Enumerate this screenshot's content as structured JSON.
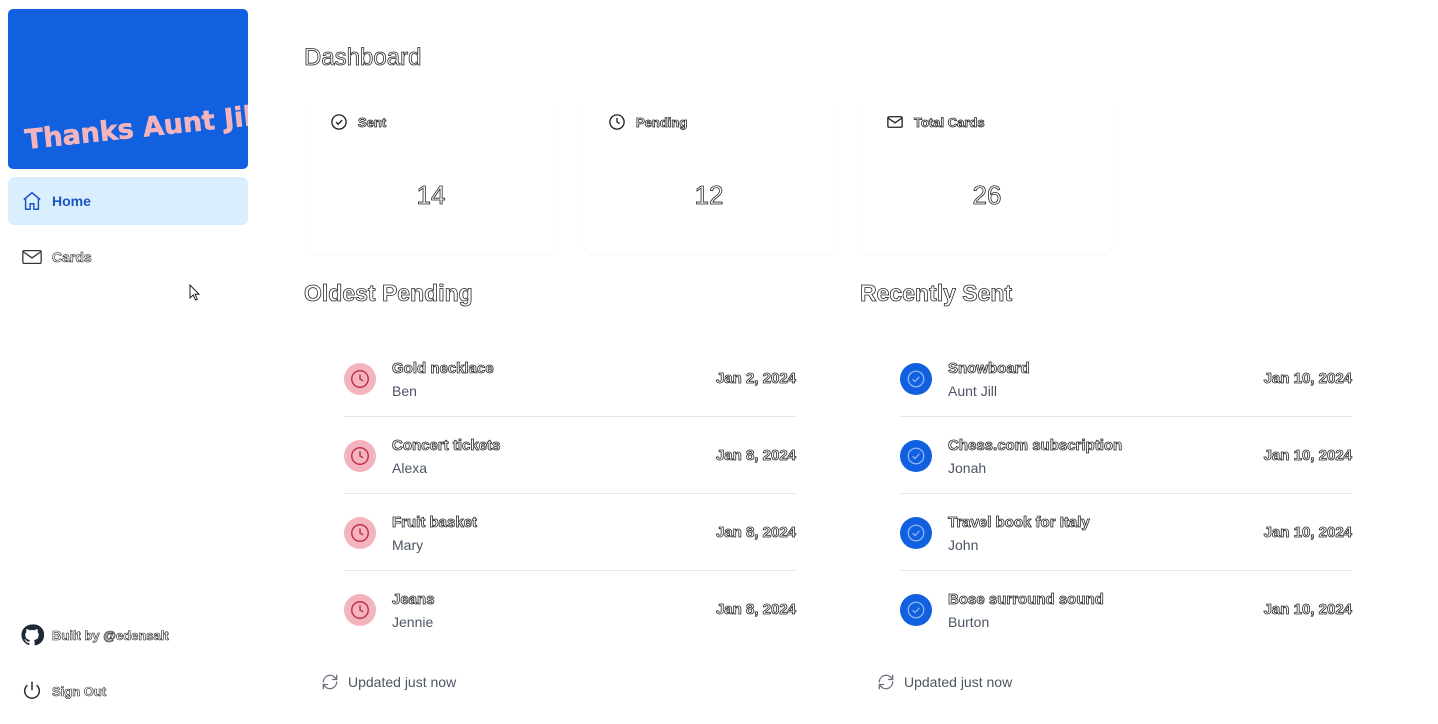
{
  "app": {
    "logo_text": "Thanks Aunt Jill"
  },
  "sidebar": {
    "items": [
      {
        "label": "Home",
        "icon": "home-icon",
        "active": true
      },
      {
        "label": "Cards",
        "icon": "mail-icon",
        "active": false
      }
    ],
    "footer": [
      {
        "label": "Built by @edensalt",
        "icon": "github-icon"
      },
      {
        "label": "Sign Out",
        "icon": "power-icon"
      }
    ]
  },
  "main": {
    "title": "Dashboard",
    "stats": [
      {
        "label": "Sent",
        "value": "14",
        "icon": "check-circle-icon"
      },
      {
        "label": "Pending",
        "value": "12",
        "icon": "clock-icon"
      },
      {
        "label": "Total Cards",
        "value": "26",
        "icon": "mail-icon"
      }
    ],
    "oldest_pending": {
      "title": "Oldest Pending",
      "items": [
        {
          "title": "Gold necklace",
          "person": "Ben",
          "date": "Jan 2, 2024"
        },
        {
          "title": "Concert tickets",
          "person": "Alexa",
          "date": "Jan 8, 2024"
        },
        {
          "title": "Fruit basket",
          "person": "Mary",
          "date": "Jan 8, 2024"
        },
        {
          "title": "Jeans",
          "person": "Jennie",
          "date": "Jan 8, 2024"
        }
      ],
      "updated": "Updated just now"
    },
    "recently_sent": {
      "title": "Recently Sent",
      "items": [
        {
          "title": "Snowboard",
          "person": "Aunt Jill",
          "date": "Jan 10, 2024"
        },
        {
          "title": "Chess.com subscription",
          "person": "Jonah",
          "date": "Jan 10, 2024"
        },
        {
          "title": "Travel book for Italy",
          "person": "John",
          "date": "Jan 10, 2024"
        },
        {
          "title": "Bose surround sound",
          "person": "Burton",
          "date": "Jan 10, 2024"
        }
      ],
      "updated": "Updated just now"
    }
  },
  "colors": {
    "brand_blue": "#1060e0",
    "nav_active_bg": "#dbeefd",
    "logo_text": "#f4b4bd",
    "pending_badge": "#f4b4bd",
    "pending_icon": "#c0304a"
  }
}
